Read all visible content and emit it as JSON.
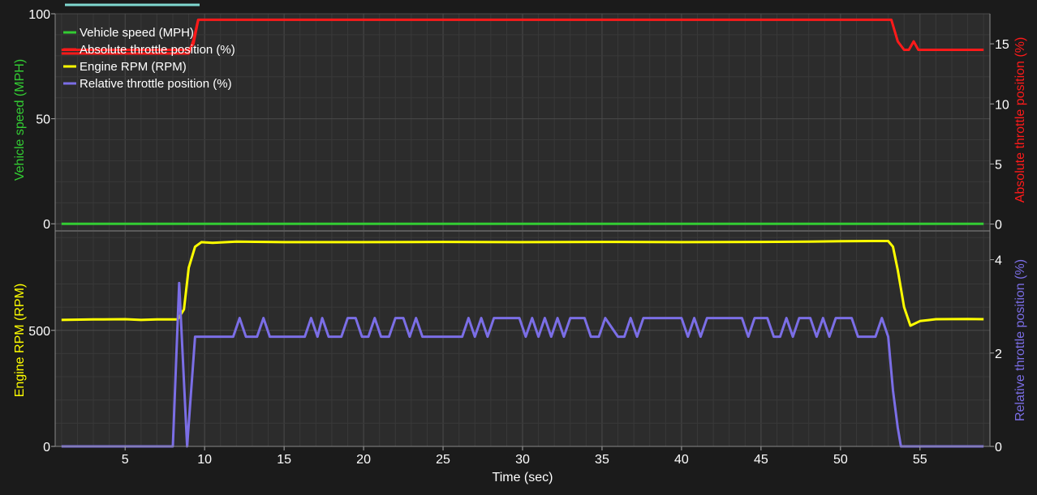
{
  "ui": {
    "background": "#1b1b1b",
    "plot_background": "#2c2c2c",
    "grid_color": "#4a4a4a",
    "minor_grid_color": "#393939",
    "axis_text_color": "#ffffff",
    "progress_bar_color": "#7fd8d0"
  },
  "chart_data": [
    {
      "type": "line",
      "panel": "top",
      "legend_placement": "top-left",
      "grid": true,
      "x_range": [
        0.6,
        59.4
      ],
      "y_left": {
        "label": "Vehicle speed (MPH)",
        "range": [
          -3,
          100
        ],
        "ticks": [
          0,
          50,
          100
        ],
        "color": "#33cc33"
      },
      "y_right": {
        "label": "Absolute throttle position (%)",
        "range": [
          -0.5,
          17.5
        ],
        "ticks": [
          0,
          5,
          10,
          15
        ],
        "color": "#ff1a1a"
      },
      "series": [
        {
          "name": "Vehicle speed (MPH)",
          "axis": "left",
          "color": "#33cc33",
          "points": [
            [
              1,
              0
            ],
            [
              59,
              0
            ]
          ]
        },
        {
          "name": "Absolute throttle position (%)",
          "axis": "right",
          "color": "#ff1a1a",
          "points": [
            [
              1,
              14.5
            ],
            [
              8.5,
              14.5
            ],
            [
              9,
              14.5
            ],
            [
              9.3,
              15
            ],
            [
              9.6,
              17
            ],
            [
              30,
              17
            ],
            [
              53,
              17
            ],
            [
              53.2,
              17
            ],
            [
              53.6,
              15.2
            ],
            [
              54,
              14.5
            ],
            [
              54.3,
              14.5
            ],
            [
              54.6,
              15.2
            ],
            [
              54.9,
              14.5
            ],
            [
              59,
              14.5
            ]
          ]
        },
        {
          "name": "Absolute throttle position (%)",
          "axis": "right",
          "color": "#ff1a1a",
          "points": [
            [
              1,
              14.2
            ],
            [
              8.5,
              14.2
            ],
            [
              9,
              14.2
            ],
            [
              9.3,
              15.3
            ],
            [
              9.6,
              17
            ]
          ]
        }
      ]
    },
    {
      "type": "line",
      "panel": "bottom",
      "grid": true,
      "x_range": [
        0.6,
        59.4
      ],
      "xlabel": "Time (sec)",
      "x_ticks": [
        5,
        10,
        15,
        20,
        25,
        30,
        35,
        40,
        45,
        50,
        55
      ],
      "y_left": {
        "label": "Engine RPM (RPM)",
        "range": [
          0,
          925
        ],
        "ticks": [
          0,
          500
        ],
        "color": "#ffff00"
      },
      "y_right": {
        "label": "Relative throttle position (%)",
        "range": [
          0,
          4.6
        ],
        "ticks": [
          0,
          2,
          4
        ],
        "color": "#7b6ee6"
      },
      "series": [
        {
          "name": "Engine RPM (RPM)",
          "axis": "left",
          "color": "#ffff00",
          "points": [
            [
              1,
              545
            ],
            [
              3,
              547
            ],
            [
              5,
              548
            ],
            [
              6,
              545
            ],
            [
              7,
              547
            ],
            [
              8.3,
              547
            ],
            [
              8.7,
              590
            ],
            [
              9.0,
              770
            ],
            [
              9.4,
              860
            ],
            [
              9.8,
              880
            ],
            [
              10.5,
              877
            ],
            [
              12,
              882
            ],
            [
              15,
              880
            ],
            [
              20,
              880
            ],
            [
              25,
              881
            ],
            [
              30,
              880
            ],
            [
              35,
              881
            ],
            [
              40,
              880
            ],
            [
              45,
              881
            ],
            [
              48,
              882
            ],
            [
              50,
              884
            ],
            [
              52,
              885
            ],
            [
              53,
              885
            ],
            [
              53.3,
              860
            ],
            [
              53.6,
              760
            ],
            [
              54.0,
              600
            ],
            [
              54.4,
              520
            ],
            [
              55,
              540
            ],
            [
              56,
              548
            ],
            [
              58,
              549
            ],
            [
              59,
              548
            ]
          ]
        },
        {
          "name": "Relative throttle position (%)",
          "axis": "right",
          "color": "#7b6ee6",
          "points": [
            [
              1,
              0
            ],
            [
              8.0,
              0
            ],
            [
              8.4,
              3.5
            ],
            [
              8.9,
              0
            ],
            [
              9.4,
              2.35
            ],
            [
              11.8,
              2.35
            ],
            [
              12.2,
              2.75
            ],
            [
              12.6,
              2.35
            ],
            [
              13.3,
              2.35
            ],
            [
              13.7,
              2.75
            ],
            [
              14.1,
              2.35
            ],
            [
              16.3,
              2.35
            ],
            [
              16.7,
              2.75
            ],
            [
              17.1,
              2.35
            ],
            [
              17.4,
              2.75
            ],
            [
              17.8,
              2.35
            ],
            [
              18.6,
              2.35
            ],
            [
              19.0,
              2.75
            ],
            [
              19.5,
              2.75
            ],
            [
              19.9,
              2.35
            ],
            [
              20.3,
              2.35
            ],
            [
              20.7,
              2.75
            ],
            [
              21.1,
              2.35
            ],
            [
              21.6,
              2.35
            ],
            [
              22.0,
              2.75
            ],
            [
              22.5,
              2.75
            ],
            [
              22.9,
              2.35
            ],
            [
              23.3,
              2.75
            ],
            [
              23.7,
              2.35
            ],
            [
              26.2,
              2.35
            ],
            [
              26.6,
              2.75
            ],
            [
              27.0,
              2.35
            ],
            [
              27.4,
              2.75
            ],
            [
              27.8,
              2.35
            ],
            [
              28.2,
              2.75
            ],
            [
              29.8,
              2.75
            ],
            [
              30.2,
              2.35
            ],
            [
              30.6,
              2.75
            ],
            [
              31.0,
              2.35
            ],
            [
              31.4,
              2.75
            ],
            [
              31.8,
              2.35
            ],
            [
              32.2,
              2.75
            ],
            [
              32.6,
              2.35
            ],
            [
              33.0,
              2.75
            ],
            [
              33.9,
              2.75
            ],
            [
              34.3,
              2.35
            ],
            [
              34.8,
              2.35
            ],
            [
              35.2,
              2.75
            ],
            [
              36.0,
              2.35
            ],
            [
              36.4,
              2.35
            ],
            [
              36.8,
              2.75
            ],
            [
              37.2,
              2.35
            ],
            [
              37.6,
              2.75
            ],
            [
              40.0,
              2.75
            ],
            [
              40.4,
              2.35
            ],
            [
              40.8,
              2.75
            ],
            [
              41.2,
              2.35
            ],
            [
              41.6,
              2.75
            ],
            [
              43.8,
              2.75
            ],
            [
              44.2,
              2.35
            ],
            [
              44.6,
              2.75
            ],
            [
              45.4,
              2.75
            ],
            [
              45.8,
              2.35
            ],
            [
              46.2,
              2.35
            ],
            [
              46.6,
              2.75
            ],
            [
              47.0,
              2.35
            ],
            [
              47.4,
              2.75
            ],
            [
              48.1,
              2.75
            ],
            [
              48.5,
              2.35
            ],
            [
              48.9,
              2.75
            ],
            [
              49.3,
              2.35
            ],
            [
              49.7,
              2.75
            ],
            [
              50.7,
              2.75
            ],
            [
              51.1,
              2.35
            ],
            [
              52.2,
              2.35
            ],
            [
              52.6,
              2.75
            ],
            [
              53.0,
              2.35
            ],
            [
              53.3,
              1.2
            ],
            [
              53.6,
              0.4
            ],
            [
              53.8,
              0
            ],
            [
              59,
              0
            ]
          ]
        }
      ]
    }
  ]
}
